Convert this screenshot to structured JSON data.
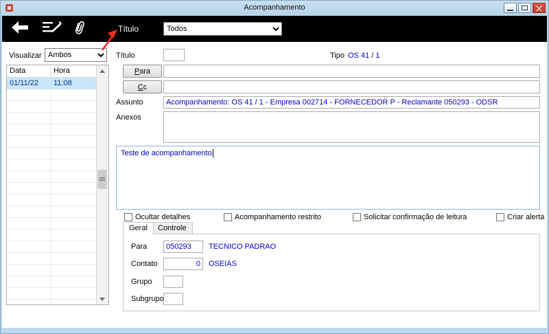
{
  "window": {
    "title": "Acompanhamento"
  },
  "toolbar": {
    "titulo_label": "Título",
    "filter_value": "Todos"
  },
  "left_panel": {
    "visualizar_label": "Visualizar",
    "visualizar_value": "Ambos",
    "columns": {
      "data": "Data",
      "hora": "Hora"
    },
    "rows": [
      {
        "data": "01/11/22",
        "hora": "11:08",
        "selected": true
      }
    ]
  },
  "form": {
    "titulo_label": "Título",
    "titulo_value": "",
    "tipo_label": "Tipo",
    "tipo_value": "OS 41 / 1",
    "para_button": "Para",
    "para_value": "",
    "cc_button": "Cc",
    "cc_value": "",
    "assunto_label": "Assunto",
    "assunto_value": "Acompanhamento: OS 41 / 1 - Empresa 002714 - FORNECEDOR P - Reclamante 050293 - ODSR",
    "anexos_label": "Anexos",
    "anexos_value": "",
    "body_text": "Teste de acompanhamento",
    "checkboxes": [
      {
        "label": "Ocultar detalhes",
        "checked": false
      },
      {
        "label": "Acompanhamento restrito",
        "checked": false
      },
      {
        "label": "Solicitar confirmação de leitura",
        "checked": false
      },
      {
        "label": "Criar alerta",
        "checked": false
      }
    ],
    "tabs": [
      {
        "label": "Geral",
        "active": true
      },
      {
        "label": "Controle",
        "active": false
      }
    ],
    "geral_tab": {
      "para_label": "Para",
      "para_value": "050293",
      "para_name": "TECNICO PADRAO",
      "contato_label": "Contato",
      "contato_value": "0",
      "contato_name": "OSEIAS",
      "grupo_label": "Grupo",
      "grupo_value": "",
      "subgrupo_label": "Subgrupo",
      "subgrupo_value": ""
    }
  },
  "colors": {
    "toolbar_bg": "#000000",
    "titlebar_bg": "#BED8EC",
    "link_text": "#0000CD",
    "selection_bg": "#C9E7F8",
    "annotation_arrow": "#FF2A2A",
    "close_button": "#C0392B"
  }
}
